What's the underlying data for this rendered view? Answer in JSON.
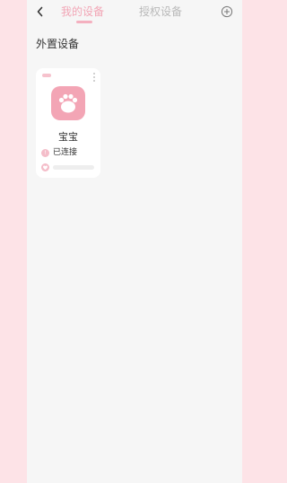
{
  "header": {
    "tabs": [
      {
        "label": "我的设备",
        "active": true
      },
      {
        "label": "授权设备",
        "active": false
      }
    ],
    "back_icon": "chevron-left-icon",
    "add_icon": "plus-circle-icon"
  },
  "section": {
    "title": "外置设备"
  },
  "devices": [
    {
      "name": "宝宝",
      "status": "已连接",
      "icon": "paw-icon",
      "status_icon": "info-icon",
      "extra_icon": "heart-icon"
    }
  ],
  "colors": {
    "accent": "#f2a6b6",
    "page_background": "#fde3e7",
    "content_background": "#f6f6f6",
    "inactive_tab": "#b9b9b9"
  }
}
